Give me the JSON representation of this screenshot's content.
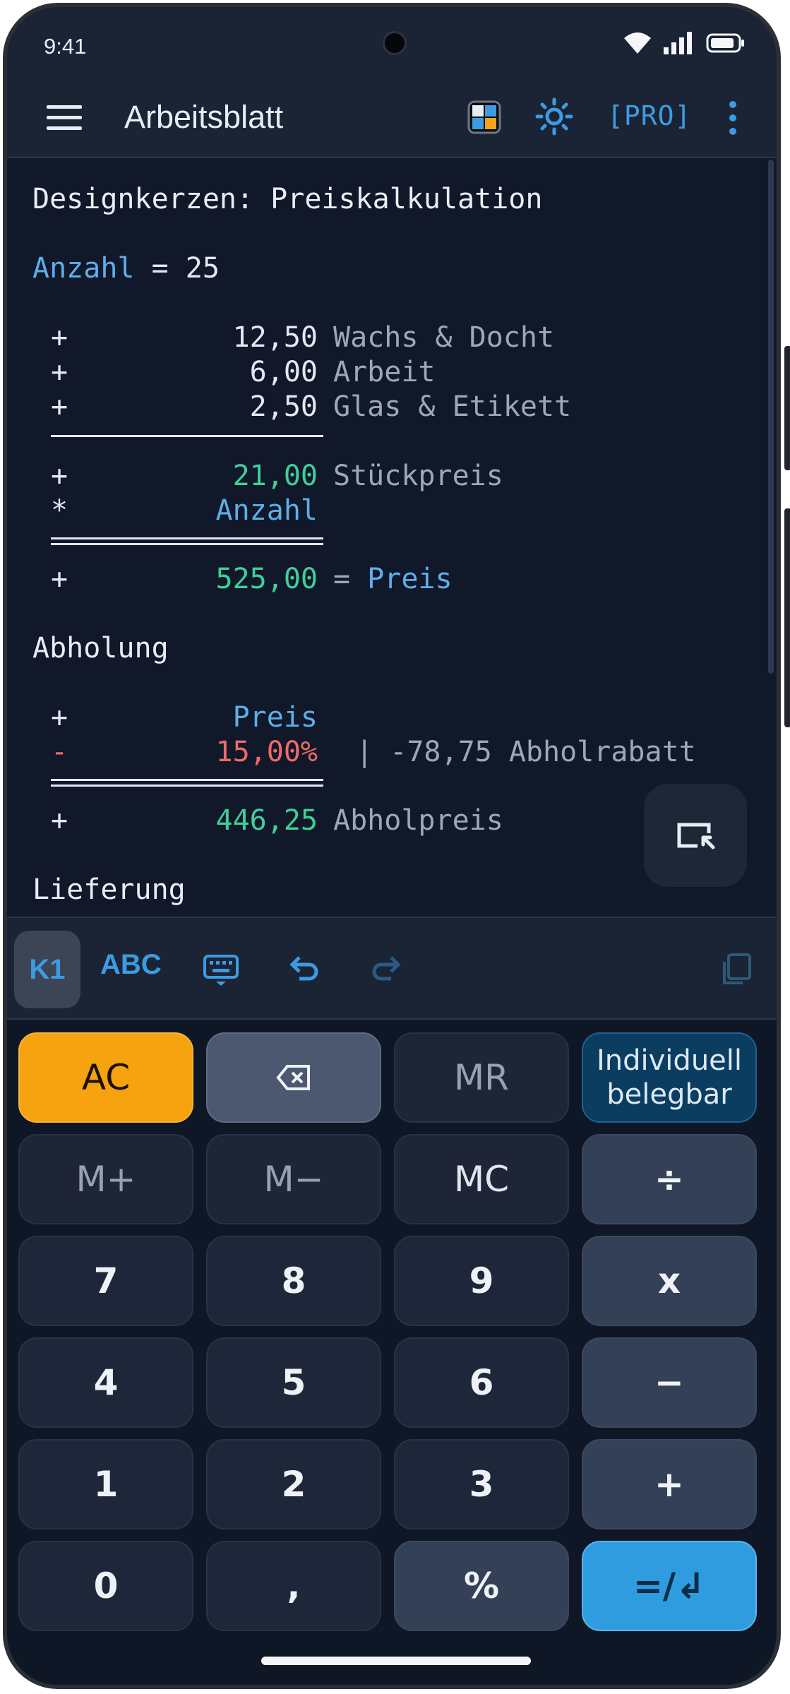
{
  "status_bar": {
    "time": "9:41"
  },
  "app_bar": {
    "title": "Arbeitsblatt",
    "pro_label": "[PRO]"
  },
  "worksheet": {
    "heading": "Designkerzen: Preiskalkulation",
    "anzahl": {
      "var": "Anzahl",
      "eq": " = ",
      "value": "25"
    },
    "rows_costs": [
      {
        "op": "+",
        "value": "12,50",
        "label": "Wachs & Docht"
      },
      {
        "op": "+",
        "value": "6,00",
        "label": "Arbeit"
      },
      {
        "op": "+",
        "value": "2,50",
        "label": "Glas & Etikett"
      }
    ],
    "stueck": {
      "op": "+",
      "value": "21,00",
      "label": "Stückpreis"
    },
    "mult": {
      "op": "*",
      "value": "Anzahl"
    },
    "preis_row": {
      "op": "+",
      "value": "525,00",
      "eq": "= ",
      "label": "Preis"
    },
    "abholung_heading": "Abholung",
    "abhol_preis_ref": {
      "op": "+",
      "value": "Preis"
    },
    "rabatt": {
      "op": "-",
      "value": "15,00%",
      "sep": " | ",
      "detail": "-78,75 Abholrabatt"
    },
    "abholpreis": {
      "op": "+",
      "value": "446,25",
      "label": "Abholpreis"
    },
    "lieferung_heading": "Lieferung"
  },
  "toolbar": {
    "k1": "K1",
    "abc": "ABC"
  },
  "keys": {
    "ac": "AC",
    "mr": "MR",
    "indiv_1": "Individuell",
    "indiv_2": "belegbar",
    "mplus": "M+",
    "mminus": "M−",
    "mc": "MC",
    "div": "÷",
    "k7": "7",
    "k8": "8",
    "k9": "9",
    "mul": "x",
    "k4": "4",
    "k5": "5",
    "k6": "6",
    "minus": "−",
    "k1": "1",
    "k2": "2",
    "k3": "3",
    "plus": "+",
    "k0": "0",
    "comma": ",",
    "percent": "%",
    "equals": "=/↲"
  },
  "colors": {
    "accent": "#3d9be2",
    "variable": "#5eaee8",
    "result": "#3fcf98",
    "negative": "#ef6a6a",
    "ac": "#f7a20f"
  }
}
